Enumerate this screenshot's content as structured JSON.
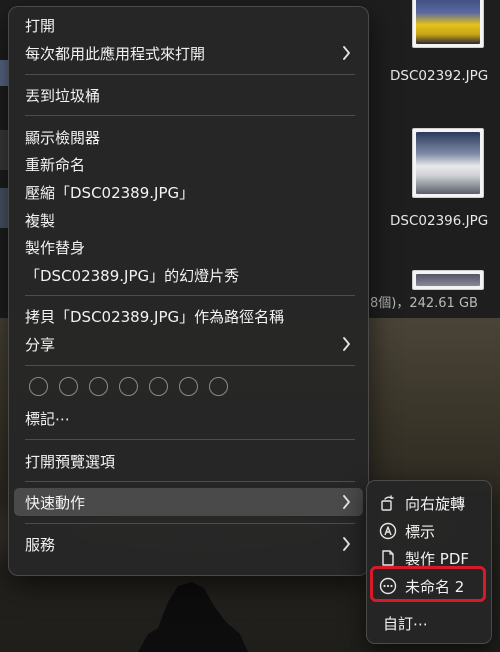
{
  "finder": {
    "file_1": "DSC02392.JPG",
    "file_2": "DSC02396.JPG",
    "status": "8個)，242.61 GB"
  },
  "context_menu": {
    "open": "打開",
    "open_with_always": "每次都用此應用程式來打開",
    "move_to_trash": "丟到垃圾桶",
    "show_inspector": "顯示檢閱器",
    "rename": "重新命名",
    "compress": "壓縮「DSC02389.JPG」",
    "duplicate": "複製",
    "make_alias": "製作替身",
    "slideshow": "「DSC02389.JPG」的幻燈片秀",
    "copy_as_pathname": "拷貝「DSC02389.JPG」作為路徑名稱",
    "share": "分享",
    "tags": "標記⋯",
    "show_preview_options": "打開預覽選項",
    "quick_actions": "快速動作",
    "services": "服務"
  },
  "quick_actions_submenu": {
    "rotate_right": "向右旋轉",
    "markup": "標示",
    "create_pdf": "製作 PDF",
    "untitled_2": "未命名 2",
    "customize": "自訂⋯"
  },
  "tag_colors": [
    "none",
    "none",
    "none",
    "none",
    "none",
    "none",
    "none"
  ],
  "colors": {
    "menu_bg": "#262626",
    "highlight": "#4a4a4a",
    "annotation_box": "#d51b2a"
  }
}
